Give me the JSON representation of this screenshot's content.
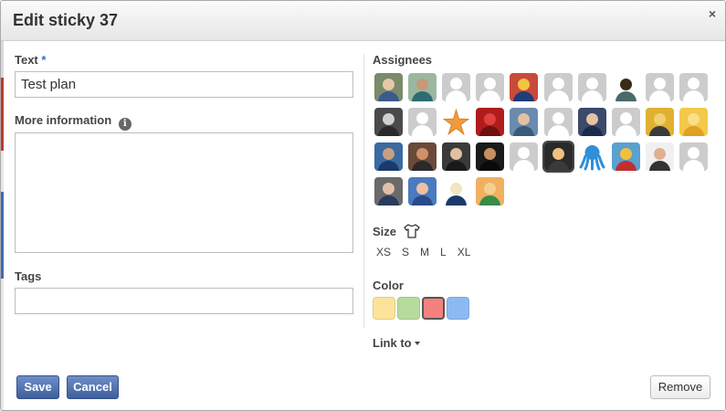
{
  "dialog": {
    "title": "Edit sticky 37",
    "close_label": "×"
  },
  "form": {
    "text_label": "Text",
    "required_mark": "*",
    "text_value": "Test plan",
    "more_info_label": "More information",
    "info_icon_glyph": "i",
    "more_info_value": "",
    "tags_label": "Tags",
    "tags_value": ""
  },
  "assignees": {
    "label": "Assignees",
    "avatars": [
      {
        "kind": "photo",
        "bg": "#7a8a6a",
        "head": "#e8c7a8",
        "body": "#3a5a8a"
      },
      {
        "kind": "photo",
        "bg": "#9bb7a0",
        "head": "#c99878",
        "body": "#2f6b73"
      },
      {
        "kind": "placeholder"
      },
      {
        "kind": "placeholder"
      },
      {
        "kind": "photo",
        "bg": "#c84a3a",
        "head": "#f2c542",
        "body": "#1e3e7a"
      },
      {
        "kind": "placeholder"
      },
      {
        "kind": "placeholder"
      },
      {
        "kind": "photo",
        "bg": "#ffffff",
        "head": "#3a2a1a",
        "body": "#4a6a6a"
      },
      {
        "kind": "placeholder"
      },
      {
        "kind": "placeholder"
      },
      {
        "kind": "photo",
        "bg": "#4a4a4a",
        "head": "#d0d0d0",
        "body": "#2a2a2a"
      },
      {
        "kind": "placeholder"
      },
      {
        "kind": "starfish"
      },
      {
        "kind": "photo",
        "bg": "#b01c1c",
        "head": "#e04040",
        "body": "#701010"
      },
      {
        "kind": "photo",
        "bg": "#6a8ab0",
        "head": "#e2c0a0",
        "body": "#3a5a7a"
      },
      {
        "kind": "placeholder"
      },
      {
        "kind": "photo",
        "bg": "#3a4a6a",
        "head": "#e6c2a2",
        "body": "#1a2a4a"
      },
      {
        "kind": "placeholder"
      },
      {
        "kind": "photo",
        "bg": "#e0b030",
        "head": "#f0d070",
        "body": "#3a3a3a"
      },
      {
        "kind": "photo",
        "bg": "#f3c94a",
        "head": "#f8e08a",
        "body": "#e0a020"
      },
      {
        "kind": "photo",
        "bg": "#3a6aa0",
        "head": "#c8a080",
        "body": "#1a3a6a"
      },
      {
        "kind": "photo",
        "bg": "#6a4a3a",
        "head": "#d0906a",
        "body": "#2a2a2a"
      },
      {
        "kind": "photo",
        "bg": "#3a3a3a",
        "head": "#e0c0a0",
        "body": "#1a1a1a"
      },
      {
        "kind": "photo",
        "bg": "#1a1a1a",
        "head": "#c89060",
        "body": "#0a0a0a"
      },
      {
        "kind": "placeholder"
      },
      {
        "kind": "photo",
        "selected": true,
        "bg": "#2a2a2a",
        "head": "#f0c080",
        "body": "#3a3a3a"
      },
      {
        "kind": "octopus"
      },
      {
        "kind": "photo",
        "bg": "#5aa0d0",
        "head": "#f0c040",
        "body": "#c03030"
      },
      {
        "kind": "photo",
        "bg": "#f0f0f0",
        "head": "#e0b090",
        "body": "#333333"
      },
      {
        "kind": "placeholder"
      },
      {
        "kind": "photo",
        "bg": "#6a6a6a",
        "head": "#e0c0a8",
        "body": "#2a3a5a"
      },
      {
        "kind": "photo",
        "bg": "#4a7ac0",
        "head": "#f0c0a0",
        "body": "#2a4a8a"
      },
      {
        "kind": "photo",
        "bg": "#ffffff",
        "head": "#f0e6c0",
        "body": "#1a3a6a"
      },
      {
        "kind": "photo",
        "bg": "#f0b060",
        "head": "#f2d090",
        "body": "#3a8a4a"
      }
    ]
  },
  "size": {
    "label": "Size",
    "icon": "tshirt-icon",
    "options": [
      "XS",
      "S",
      "M",
      "L",
      "XL"
    ]
  },
  "color": {
    "label": "Color",
    "swatches": [
      {
        "name": "yellow",
        "hex": "#fde39a",
        "selected": false
      },
      {
        "name": "green",
        "hex": "#b5dc9b",
        "selected": false
      },
      {
        "name": "red",
        "hex": "#f4817f",
        "selected": true
      },
      {
        "name": "blue",
        "hex": "#8db9f3",
        "selected": false
      }
    ]
  },
  "link_to": {
    "label": "Link to"
  },
  "buttons": {
    "save": "Save",
    "cancel": "Cancel",
    "remove": "Remove"
  }
}
